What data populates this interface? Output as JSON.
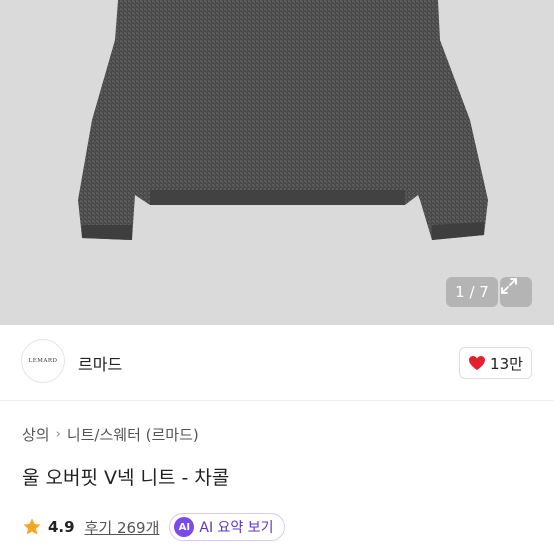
{
  "gallery": {
    "counter": "1 / 7",
    "expand_icon": "expand-icon",
    "image_alt": "charcoal wool sweater"
  },
  "store": {
    "logo_text": "LEMARD",
    "name": "르마드",
    "like_count": "13만",
    "like_color": "#e5202e"
  },
  "breadcrumb": {
    "items": [
      "상의",
      "니트/스웨터 (르마드)"
    ]
  },
  "product": {
    "title": "울 오버핏 V넥 니트 - 차콜"
  },
  "rating": {
    "value": "4.9",
    "reviews_label": "후기 269개",
    "star_color": "#f5a623",
    "ai_badge": "AI",
    "ai_label": "AI 요약 보기",
    "ai_color": "#7b4bea"
  }
}
